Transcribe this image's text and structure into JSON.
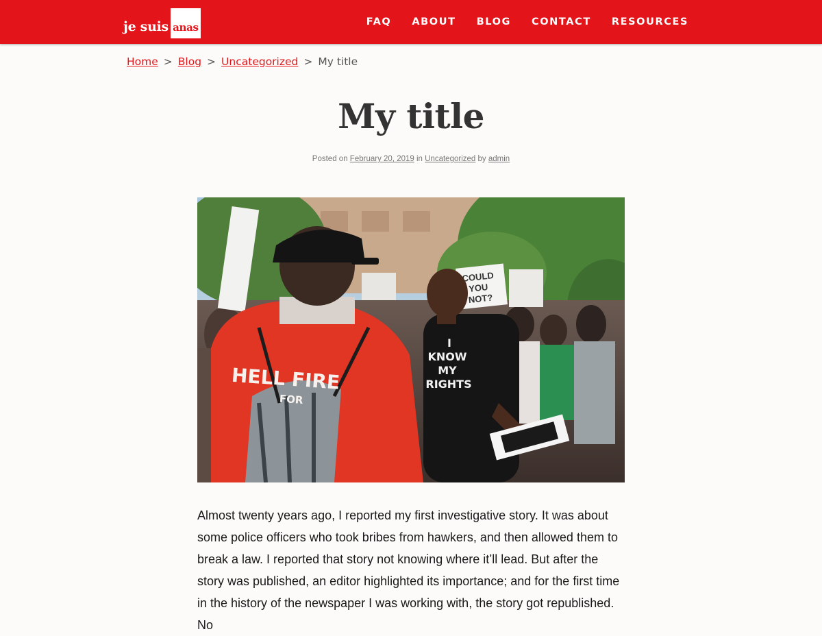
{
  "header": {
    "logo_prefix": "je suis",
    "logo_box": "anas",
    "nav": [
      "FAQ",
      "ABOUT",
      "BLOG",
      "CONTACT",
      "RESOURCES"
    ]
  },
  "breadcrumb": {
    "home": "Home",
    "blog": "Blog",
    "category": "Uncategorized",
    "current": "My title",
    "separator": ">"
  },
  "post": {
    "title": "My title",
    "meta": {
      "posted_on": "Posted on",
      "date": "February 20, 2019",
      "in": "in",
      "category": "Uncategorized",
      "by": "by",
      "author": "admin"
    },
    "image": {
      "back_shirt_line1": "HELL FIRE",
      "back_shirt_line2": "FOR",
      "front_shirt": [
        "I",
        "KNOW",
        "MY",
        "RIGHTS"
      ],
      "sign_text": [
        "COULD",
        "YOU",
        "NOT?"
      ]
    },
    "body": "Almost twenty years ago, I reported my first investigative story. It was about some police officers who took bribes from hawkers, and then allowed them to break a law. I reported that story not knowing where it’ll lead. But after the story was published, an editor highlighted its importance; and for the first time in the history of the newspaper I was working with, the story got republished. No"
  },
  "colors": {
    "brand_red": "#e3151a",
    "page_bg": "#fcfbf9"
  }
}
